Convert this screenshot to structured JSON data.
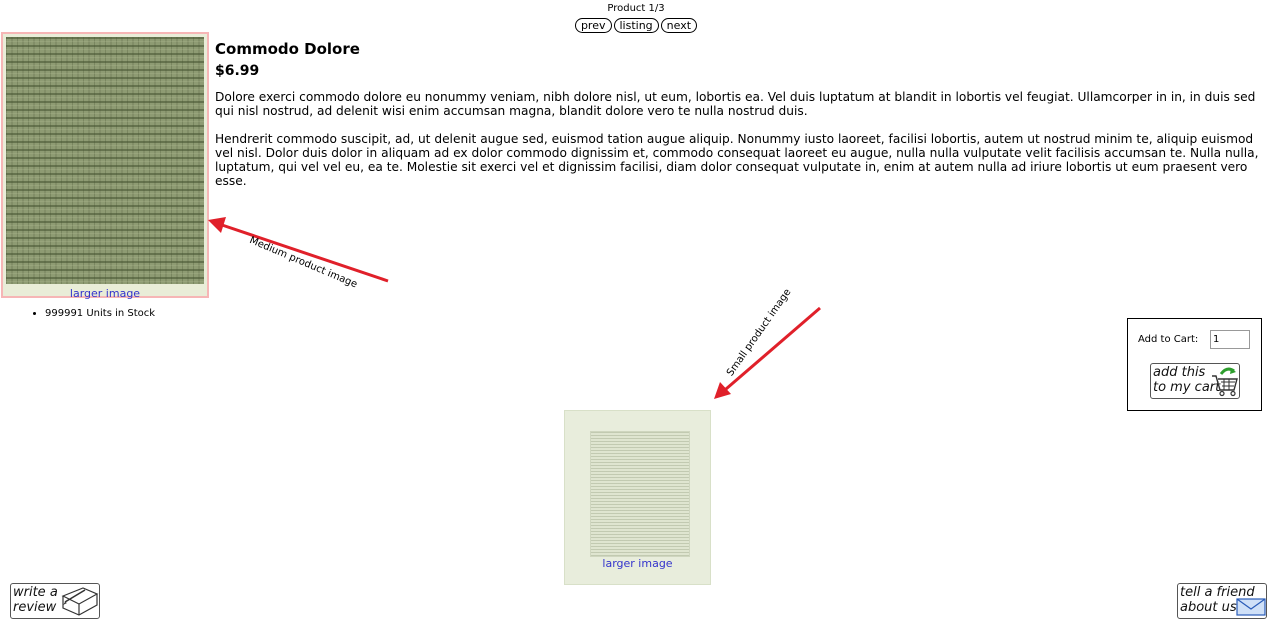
{
  "nav": {
    "counter": "Product 1/3",
    "prev_label": "prev",
    "listing_label": "listing",
    "next_label": "next"
  },
  "product": {
    "title": "Commodo Dolore",
    "price": "$6.99",
    "description": [
      "Dolore exerci commodo dolore eu nonummy veniam, nibh dolore nisl, ut eum, lobortis ea. Vel duis luptatum at blandit in lobortis vel feugiat. Ullamcorper in in, in duis sed qui nisl nostrud, ad delenit wisi enim accumsan magna, blandit dolore vero te nulla nostrud duis.",
      "Hendrerit commodo suscipit, ad, ut delenit augue sed, euismod tation augue aliquip. Nonummy iusto laoreet, facilisi lobortis, autem ut nostrud minim te, aliquip euismod vel nisl. Dolor duis dolor in aliquam ad ex dolor commodo dignissim et, commodo consequat laoreet eu augue, nulla nulla vulputate velit facilisis accumsan te. Nulla nulla, luptatum, qui vel vel eu, ea te. Molestie sit exerci vel et dignissim facilisi, diam dolor consequat vulputate in, enim at autem nulla ad iriure lobortis ut eum praesent vero esse."
    ],
    "stock": "999991 Units in Stock"
  },
  "medium_image": {
    "link_label": "larger image"
  },
  "small_image": {
    "link_label": "larger image"
  },
  "cart": {
    "label": "Add to Cart:",
    "quantity": "1",
    "button_line1": "add this",
    "button_line2": "to my cart"
  },
  "buttons": {
    "review_line1": "write a",
    "review_line2": "review",
    "friend_line1": "tell a friend",
    "friend_line2": "about us"
  },
  "annotations": {
    "medium": "Medium product image",
    "small": "Small product image"
  },
  "colors": {
    "link": "#3333cc",
    "arrow": "#e0202a",
    "medium_border": "#f6b6b6"
  }
}
